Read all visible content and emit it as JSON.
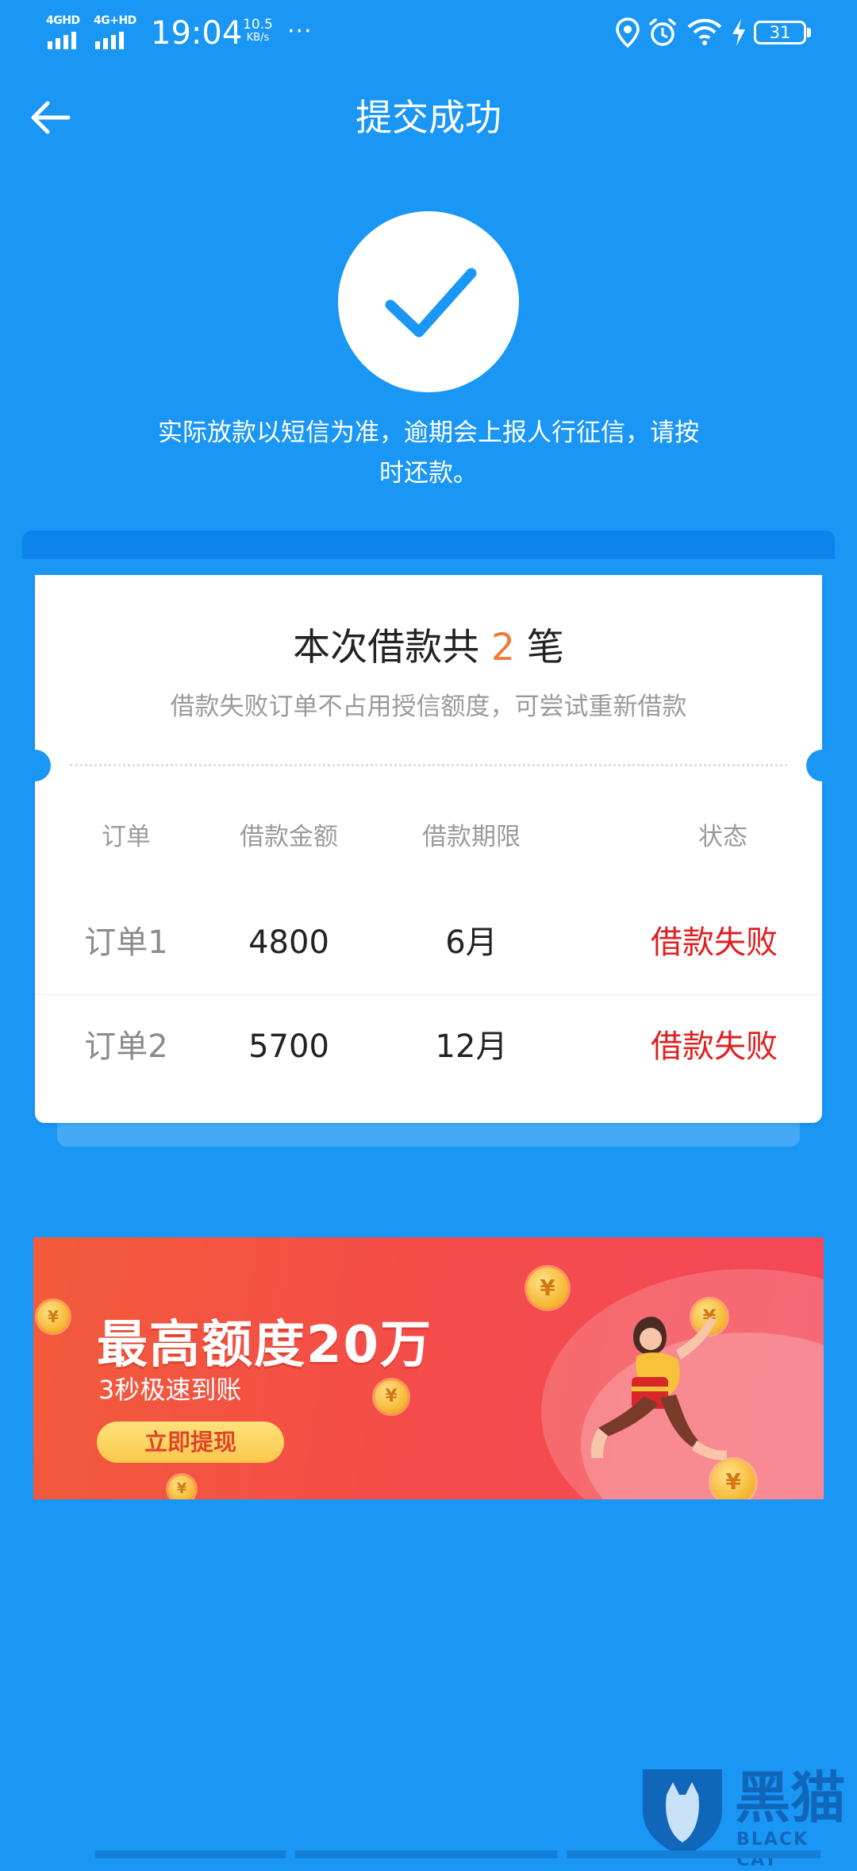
{
  "status_bar": {
    "net1": "4GHD",
    "net2": "4G+HD",
    "time": "19:04",
    "speed_value": "10.5",
    "speed_unit": "KB/s",
    "more": "···",
    "battery": "31"
  },
  "nav": {
    "title": "提交成功"
  },
  "notice": {
    "line1": "实际放款以短信为准，逾期会上报人行征信，请按",
    "line2": "时还款。"
  },
  "card": {
    "title_prefix": "本次借款共",
    "count": "2",
    "title_suffix": "笔",
    "subtitle": "借款失败订单不占用授信额度，可尝试重新借款",
    "headers": [
      "订单",
      "借款金额",
      "借款期限",
      "状态"
    ],
    "rows": [
      {
        "order": "订单1",
        "amount": "4800",
        "term": "6月",
        "status": "借款失败"
      },
      {
        "order": "订单2",
        "amount": "5700",
        "term": "12月",
        "status": "借款失败"
      }
    ]
  },
  "banner": {
    "headline": "最高额度20万",
    "subline": "3秒极速到账",
    "button": "立即提现"
  },
  "watermark": {
    "text": "黑猫",
    "sub": "BLACK CAT"
  },
  "colors": {
    "background": "#1a96f5",
    "count_accent": "#f07a3a",
    "status_fail": "#e02020"
  }
}
